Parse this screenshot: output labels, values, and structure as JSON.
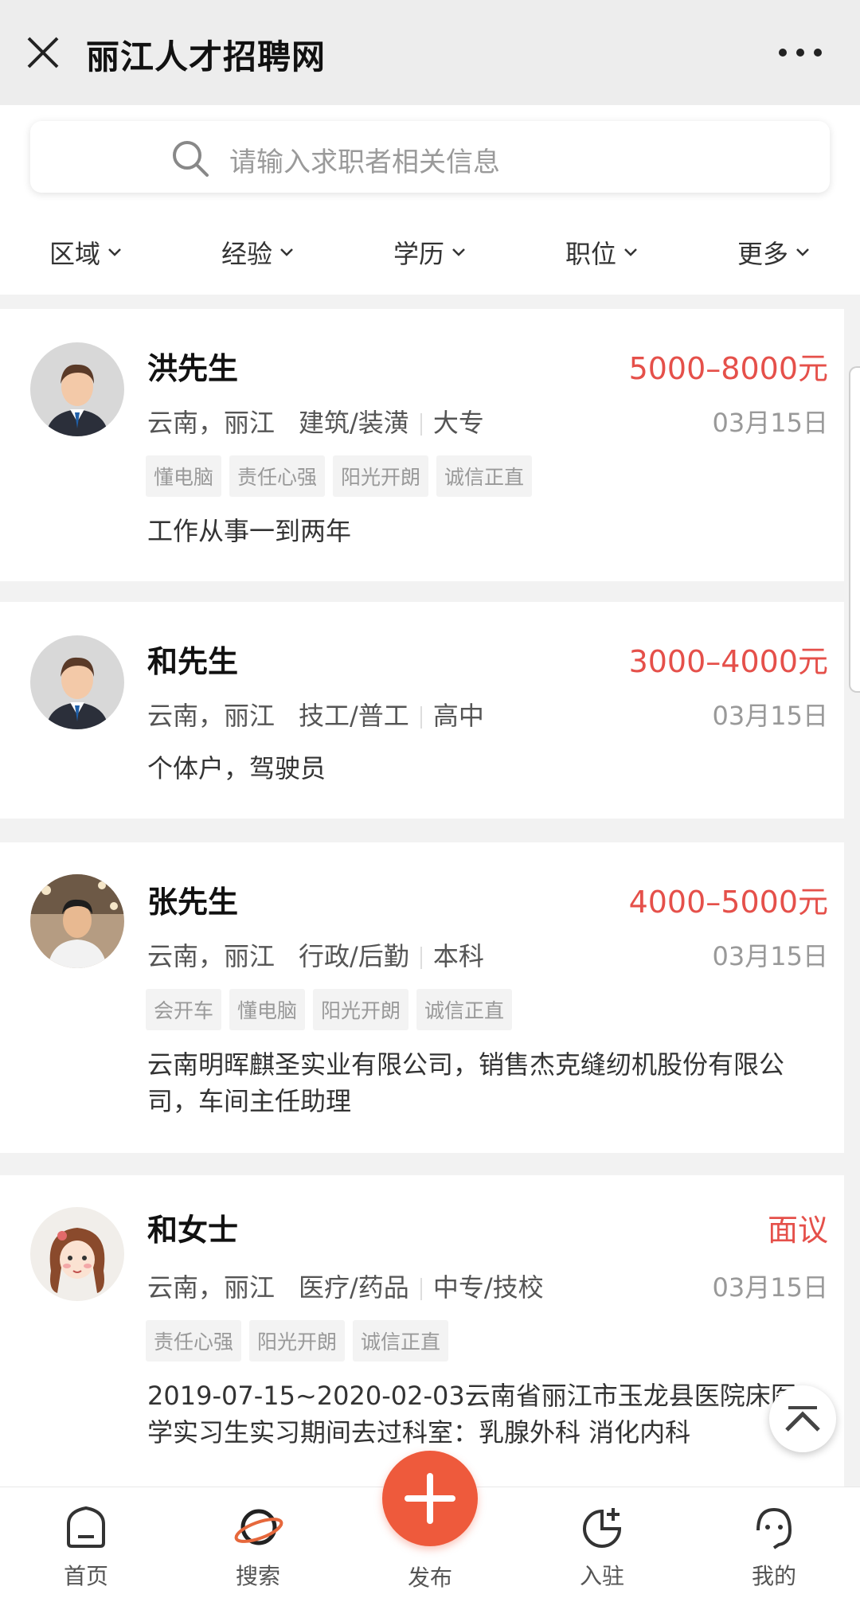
{
  "titlebar": {
    "title": "丽江人才招聘网"
  },
  "search": {
    "placeholder": "请输入求职者相关信息"
  },
  "filters": [
    "区域",
    "经验",
    "学历",
    "职位",
    "更多"
  ],
  "candidates": [
    {
      "name": "洪先生",
      "salary": "5000–8000元",
      "location": "云南，丽江",
      "category": "建筑/装潢",
      "education": "大专",
      "date": "03月15日",
      "tags": [
        "懂电脑",
        "责任心强",
        "阳光开朗",
        "诚信正直"
      ],
      "description": "工作从事一到两年"
    },
    {
      "name": "和先生",
      "salary": "3000–4000元",
      "location": "云南，丽江",
      "category": "技工/普工",
      "education": "高中",
      "date": "03月15日",
      "tags": [],
      "description": "个体户，驾驶员"
    },
    {
      "name": "张先生",
      "salary": "4000–5000元",
      "location": "云南，丽江",
      "category": "行政/后勤",
      "education": "本科",
      "date": "03月15日",
      "tags": [
        "会开车",
        "懂电脑",
        "阳光开朗",
        "诚信正直"
      ],
      "description": "云南明晖麒圣实业有限公司，销售杰克缝纫机股份有限公司，车间主任助理"
    },
    {
      "name": "和女士",
      "salary": "面议",
      "location": "云南，丽江",
      "category": "医疗/药品",
      "education": "中专/技校",
      "date": "03月15日",
      "tags": [
        "责任心强",
        "阳光开朗",
        "诚信正直"
      ],
      "description": "2019-07-15~2020-02-03云南省丽江市玉龙县医院床医学实习生实习期间去过科室：乳腺外科 消化内科"
    }
  ],
  "tabbar": [
    "首页",
    "搜索",
    "发布",
    "入驻",
    "我的"
  ],
  "colors": {
    "accent": "#e5504a",
    "publish": "#ee5a3c"
  }
}
